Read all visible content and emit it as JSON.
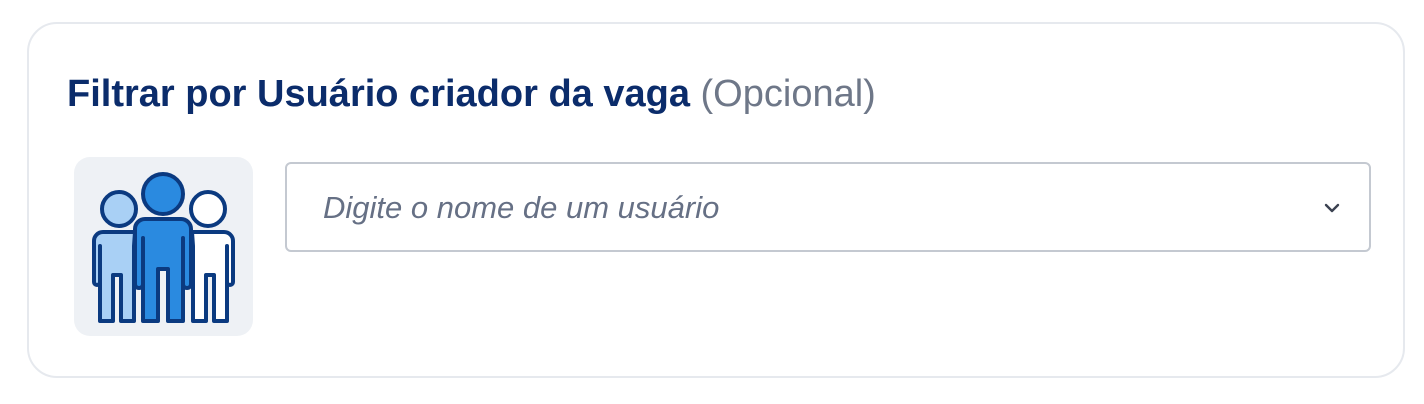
{
  "filter": {
    "title": "Filtrar por Usuário criador da vaga",
    "optional_label": "(Opcional)",
    "illustration_icon": "users-group-icon",
    "user_select": {
      "value": "",
      "placeholder": "Digite o nome de um usuário",
      "dropdown_icon": "chevron-down-icon"
    }
  },
  "colors": {
    "title": "#0b2c6b",
    "optional": "#6e7788",
    "person_left": "#a9d0f5",
    "person_center": "#2a8ae0",
    "person_right": "#ffffff",
    "outline": "#0b3a80",
    "illustration_bg": "#eef1f5"
  }
}
